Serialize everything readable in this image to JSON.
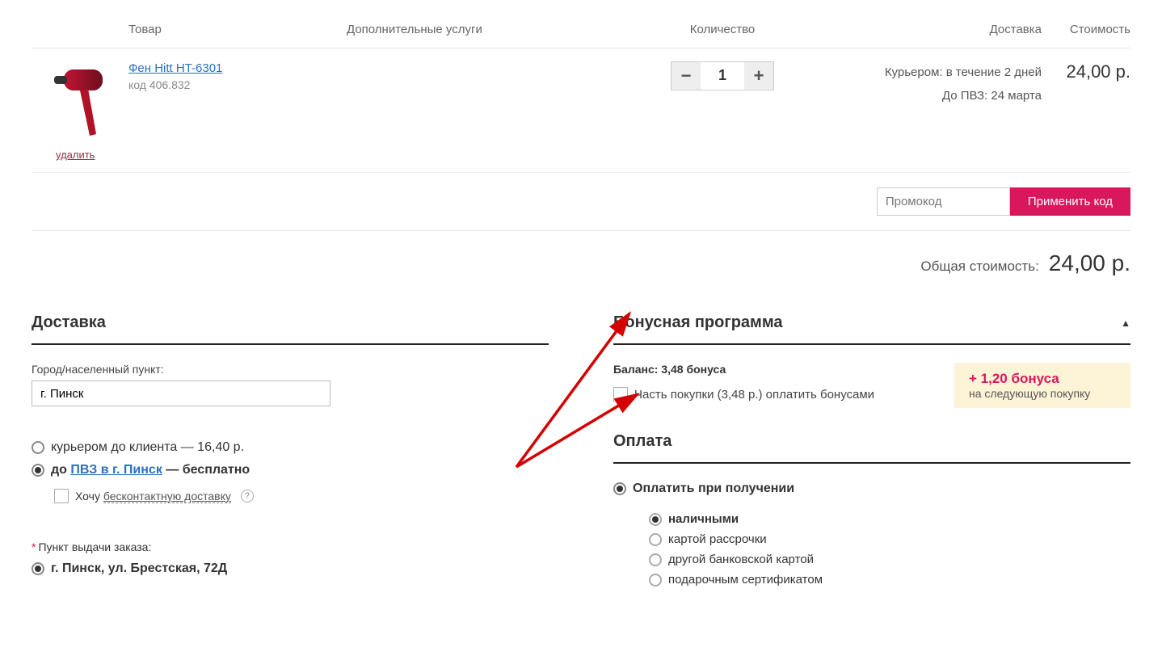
{
  "cart": {
    "headers": {
      "product": "Товар",
      "extra": "Дополнительные услуги",
      "qty": "Количество",
      "delivery": "Доставка",
      "cost": "Стоимость"
    },
    "item": {
      "name": "Фен Hitt HT-6301",
      "code": "код 406.832",
      "qty": "1",
      "delivery_line1": "Курьером: в течение 2 дней",
      "delivery_line2": "До ПВЗ: 24 марта",
      "price": "24,00 р.",
      "remove": "удалить"
    },
    "promo": {
      "placeholder": "Промокод",
      "apply": "Применить код"
    },
    "total": {
      "label": "Общая стоимость:",
      "value": "24,00 р."
    }
  },
  "delivery": {
    "title": "Доставка",
    "city_label": "Город/населенный пункт:",
    "city_value": "г. Пинск",
    "opt_courier": "курьером до клиента — 16,40 р.",
    "opt_pvz_pre": "до ",
    "opt_pvz_link": "ПВЗ в г. Пинск",
    "opt_pvz_post": " — бесплатно",
    "contactless_pre": "Хочу ",
    "contactless_link": "бесконтактную доставку",
    "pickup_label": "Пункт выдачи заказа:",
    "pickup_value": "г. Пинск, ул. Брестская, 72Д"
  },
  "bonus": {
    "title": "Бонусная программа",
    "balance": "Баланс: 3,48 бонуса",
    "plus": "+ 1,20 бонуса",
    "next": "на следующую покупку",
    "pay_part": "Часть покупки (3,48 р.) оплатить бонусами"
  },
  "payment": {
    "title": "Оплата",
    "main": "Оплатить при получении",
    "sub": [
      "наличными",
      "картой рассрочки",
      "другой банковской картой",
      "подарочным сертификатом"
    ]
  }
}
